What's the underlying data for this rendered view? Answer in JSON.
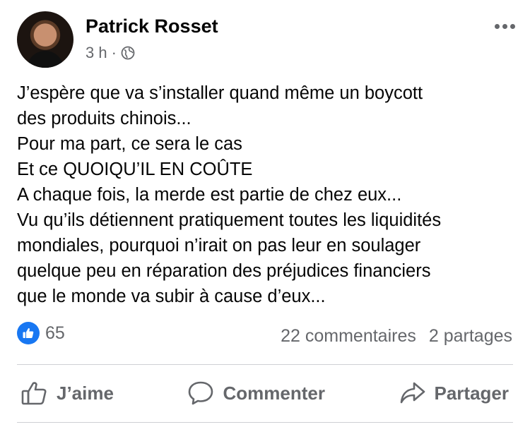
{
  "post": {
    "author": "Patrick Rosset",
    "time": "3 h",
    "separator": "·",
    "privacy_icon": "globe-icon",
    "more_icon": "more-options-icon",
    "lines": [
      "J’espère que va s’installer quand même un boycott",
      "des produits chinois...",
      "Pour ma part, ce sera le cas",
      "Et ce QUOIQU’IL EN COÛTE",
      "A chaque fois, la merde est partie de chez eux...",
      "Vu qu’ils détiennent pratiquement toutes les liquidités",
      "mondiales, pourquoi n’irait on pas leur en soulager",
      "quelque peu en réparation des préjudices financiers",
      "que le monde va subir à cause d’eux..."
    ]
  },
  "stats": {
    "reaction_count": "65",
    "comments": "22 commentaires",
    "shares": "2 partages"
  },
  "actions": {
    "like": "J’aime",
    "comment": "Commenter",
    "share": "Partager"
  },
  "colors": {
    "facebook_blue": "#1877f2",
    "secondary_text": "#65676b",
    "divider": "#ced0d4"
  }
}
